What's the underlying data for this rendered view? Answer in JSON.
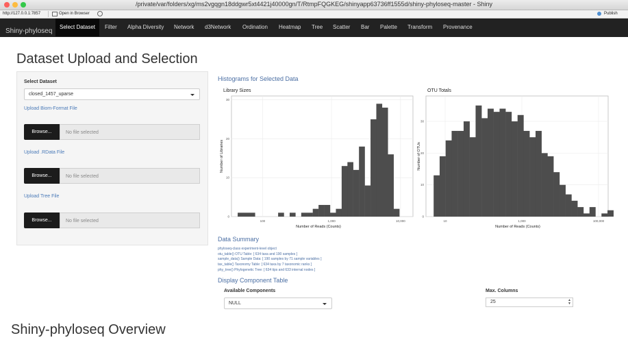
{
  "window": {
    "title": "/private/var/folders/xg/ms2vgqgn18ddgwr5xt4421j40000gn/T/RtmpFQGKEG/shinyapp63736ff1555d/shiny-phyloseq-master - Shiny",
    "url": "http://127.0.0.1:7857",
    "open_in_browser": "Open in Browser",
    "publish": "Publish"
  },
  "nav": {
    "brand": "Shiny-phyloseq",
    "items": [
      "Select Dataset",
      "Filter",
      "Alpha Diversity",
      "Network",
      "d3Network",
      "Ordination",
      "Heatmap",
      "Tree",
      "Scatter",
      "Bar",
      "Palette",
      "Transform",
      "Provenance"
    ]
  },
  "page": {
    "title": "Dataset Upload and Selection",
    "overview_title": "Shiny-phyloseq Overview"
  },
  "sidebar": {
    "select_label": "Select Dataset",
    "selected_dataset": "closed_1457_uparse",
    "uploads": [
      {
        "prefix": "Upload ",
        "link": "Biom-Format",
        "suffix": " File",
        "button": "Browse...",
        "placeholder": "No file selected"
      },
      {
        "prefix": "Upload ",
        "link": ".RData",
        "suffix": " File",
        "button": "Browse...",
        "placeholder": "No file selected"
      },
      {
        "prefix": "Upload ",
        "link": "Tree",
        "suffix": " File",
        "button": "Browse...",
        "placeholder": "No file selected"
      }
    ]
  },
  "histograms": {
    "heading": "Histograms for Selected Data"
  },
  "summary": {
    "heading": "Data Summary",
    "lines": [
      "phyloseq-class experiment-level object",
      "otu_table()   OTU Table:         [ 634 taxa and 190 samples ]",
      "sample_data() Sample Data:       [ 190 samples by 71 sample variables ]",
      "tax_table()   Taxonomy Table:    [ 634 taxa by 7 taxonomic ranks ]",
      "phy_tree()    Phylogenetic Tree: [ 634 tips and 633 internal nodes ]"
    ]
  },
  "component_table": {
    "heading": "Display Component Table",
    "available_label": "Available Components",
    "available_value": "NULL",
    "max_columns_label": "Max. Columns",
    "max_columns_value": "25"
  },
  "chart_data": [
    {
      "type": "bar",
      "title": "Library Sizes",
      "xlabel": "Number of Reads (Counts)",
      "ylabel": "Number of Libraries",
      "x_scale": "log10",
      "x_ticks": [
        {
          "value": 100,
          "label": "100"
        },
        {
          "value": 1000,
          "label": "1,000"
        },
        {
          "value": 10000,
          "label": "10,000"
        }
      ],
      "y_ticks": [
        0,
        10,
        20,
        30
      ],
      "ylim": [
        0,
        31
      ],
      "xlim_log10": [
        1.55,
        4.18
      ],
      "bin_start_log10": 1.64,
      "bin_width_log10": 0.0837,
      "values": [
        1,
        1,
        1,
        0,
        0,
        0,
        0,
        1,
        0,
        1,
        0,
        1,
        1,
        2,
        3,
        3,
        1,
        2,
        13,
        14,
        12,
        18,
        8,
        25,
        29,
        28,
        16,
        2
      ],
      "grid": true,
      "bar_color": "#4d4d4d"
    },
    {
      "type": "bar",
      "title": "OTU Totals",
      "xlabel": "Number of Reads (Counts)",
      "ylabel": "Number of OTUs",
      "x_scale": "log10",
      "x_ticks": [
        {
          "value": 10,
          "label": "10"
        },
        {
          "value": 1000,
          "label": "1,000"
        },
        {
          "value": 100000,
          "label": "100,000"
        }
      ],
      "y_ticks": [
        0,
        10,
        20,
        30
      ],
      "ylim": [
        0,
        38
      ],
      "xlim_log10": [
        0.5,
        5.25
      ],
      "bin_start_log10": 0.7,
      "bin_width_log10": 0.1563,
      "values": [
        13,
        19,
        24,
        27,
        27,
        30,
        25,
        35,
        31,
        34,
        33,
        34,
        33,
        30,
        32,
        27,
        25,
        27,
        20,
        19,
        14,
        10,
        7,
        5,
        3,
        1,
        3,
        0,
        1,
        2
      ],
      "grid": true,
      "bar_color": "#4d4d4d"
    }
  ]
}
